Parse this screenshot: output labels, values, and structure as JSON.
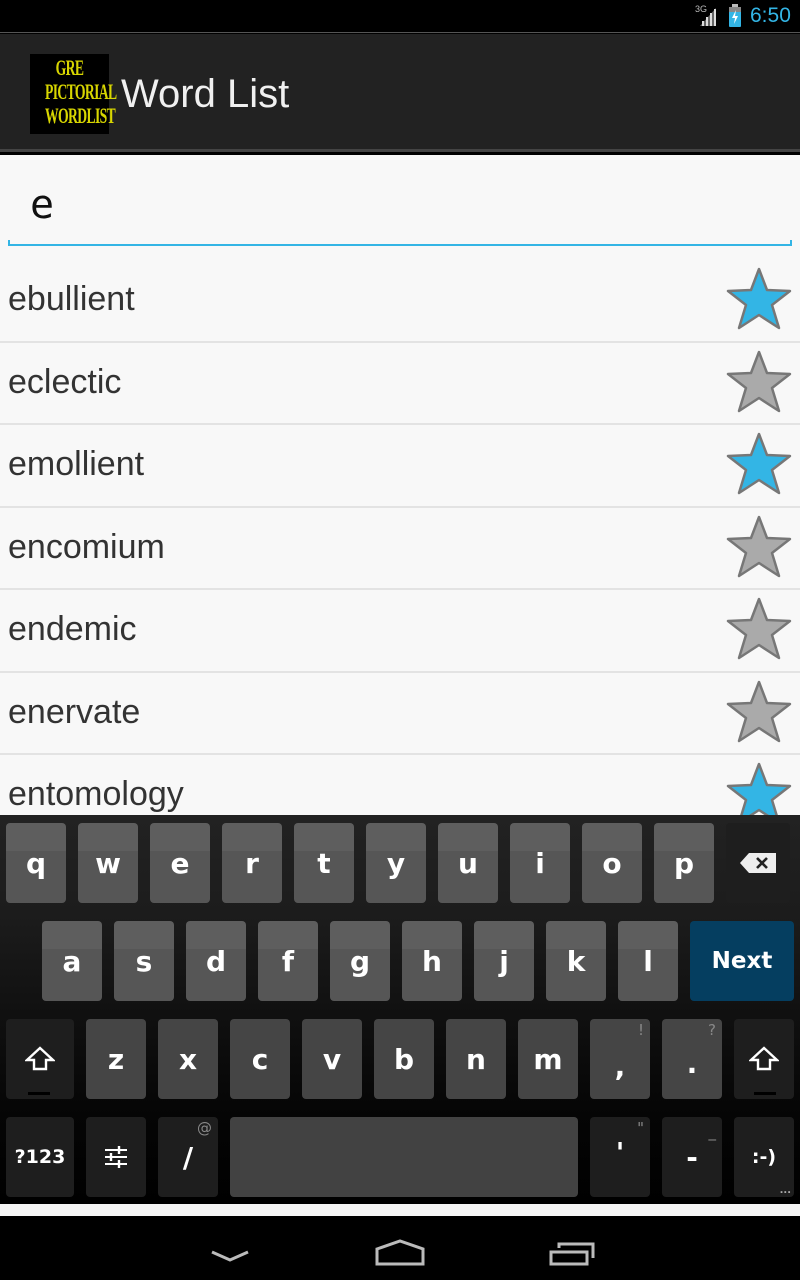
{
  "status_bar": {
    "network_label": "3G",
    "time": "6:50",
    "battery": "charging"
  },
  "action_bar": {
    "logo_lines": [
      "GRE",
      "PICTORIAL",
      "WORDLIST"
    ],
    "title": "Word List"
  },
  "search": {
    "value": "e",
    "placeholder": ""
  },
  "word_list": [
    {
      "word": "ebullient",
      "starred": true
    },
    {
      "word": "eclectic",
      "starred": false
    },
    {
      "word": "emollient",
      "starred": true
    },
    {
      "word": "encomium",
      "starred": false
    },
    {
      "word": "endemic",
      "starred": false
    },
    {
      "word": "enervate",
      "starred": false
    },
    {
      "word": "entomology",
      "starred": true
    }
  ],
  "colors": {
    "accent": "#33b5e5",
    "star_on": "#33b5e5",
    "star_off": "#aaaaaa",
    "next_key": "#053e60"
  },
  "keyboard": {
    "row1": [
      "q",
      "w",
      "e",
      "r",
      "t",
      "y",
      "u",
      "i",
      "o",
      "p"
    ],
    "row2": [
      "a",
      "s",
      "d",
      "f",
      "g",
      "h",
      "j",
      "k",
      "l"
    ],
    "row3": [
      "z",
      "x",
      "c",
      "v",
      "b",
      "n",
      "m"
    ],
    "comma": {
      "label": ",",
      "hint": "!"
    },
    "period": {
      "label": ".",
      "hint": "?"
    },
    "slash": {
      "label": "/",
      "hint": "@"
    },
    "apostrophe": {
      "label": "'",
      "hint": "\""
    },
    "dash": {
      "label": "-",
      "hint": "_"
    },
    "symbols_label": "?123",
    "emoticon_label": ":-)",
    "emoticon_more": "...",
    "next_label": "Next",
    "backspace_icon": "backspace-icon",
    "shift_icon": "shift-icon",
    "settings_icon": "settings-sliders-icon"
  },
  "nav_bar": {
    "back_icon": "back-chevron-down-icon",
    "home_icon": "home-icon",
    "recents_icon": "recent-apps-icon"
  }
}
